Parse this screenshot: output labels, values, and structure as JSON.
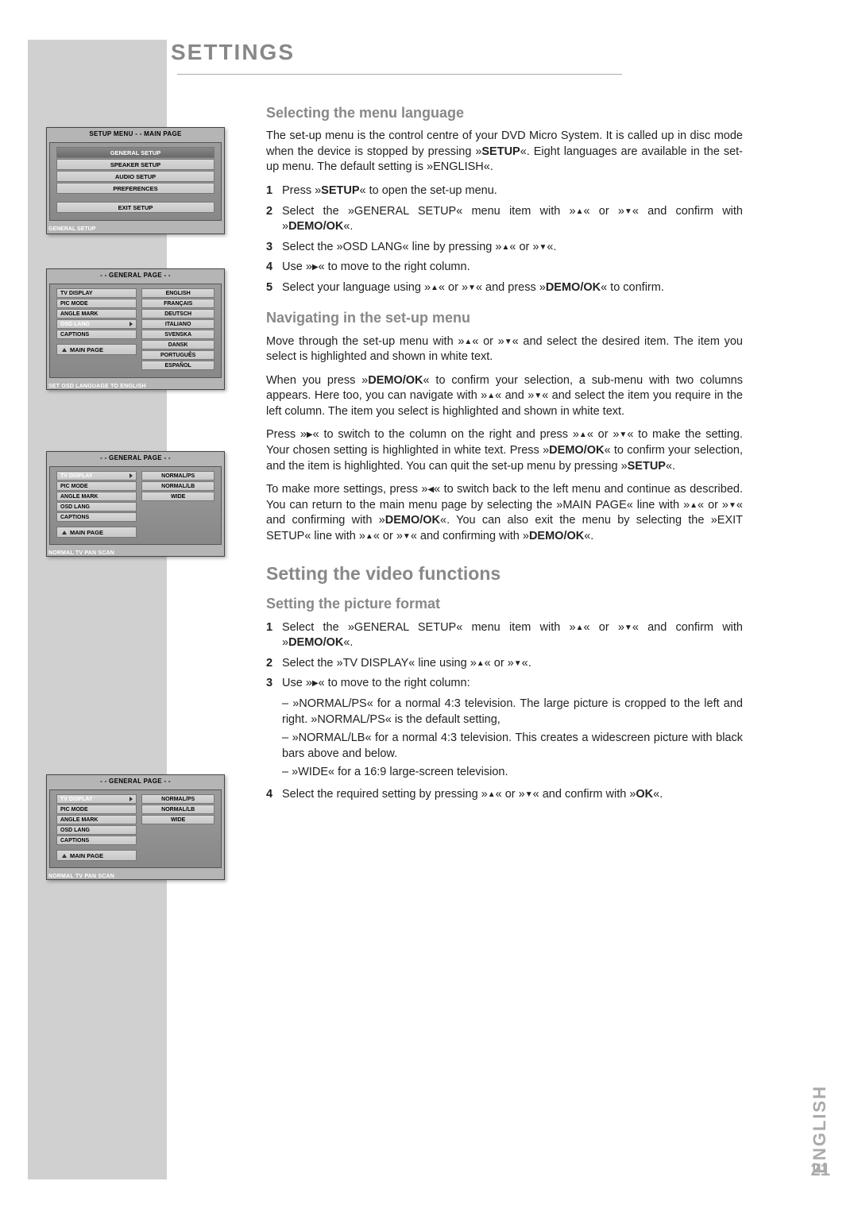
{
  "header": "SETTINGS",
  "page_language": "ENGLISH",
  "page_number": "21",
  "osd1": {
    "title": "SETUP MENU - - MAIN PAGE",
    "items": [
      "GENERAL SETUP",
      "SPEAKER SETUP",
      "AUDIO SETUP",
      "PREFERENCES"
    ],
    "exit": "EXIT SETUP",
    "status": "GENERAL SETUP"
  },
  "osd2": {
    "title": "- - GENERAL PAGE - -",
    "left": [
      "TV DISPLAY",
      "PIC MODE",
      "ANGLE MARK",
      "OSD LANG",
      "CAPTIONS"
    ],
    "selected_left": "OSD LANG",
    "right": [
      "ENGLISH",
      "FRANÇAIS",
      "DEUTSCH",
      "ITALIANO",
      "SVENSKA",
      "DANSK",
      "PORTUGUÊS",
      "ESPAÑOL"
    ],
    "selected_right": "ENGLISH",
    "nav": "MAIN PAGE",
    "foot": "SET OSD LANGUAGE TO ENGLISH"
  },
  "osd3": {
    "title": "- - GENERAL PAGE - -",
    "left": [
      "TV DISPLAY",
      "PIC MODE",
      "ANGLE MARK",
      "OSD LANG",
      "CAPTIONS"
    ],
    "selected_left": "TV DISPLAY",
    "right": [
      "NORMAL/PS",
      "NORMAL/LB",
      "WIDE"
    ],
    "selected_right": "NORMAL/PS",
    "nav": "MAIN PAGE",
    "foot": "NORMAL TV PAN SCAN"
  },
  "osd4": {
    "title": "- - GENERAL PAGE - -",
    "left": [
      "TV DISPLAY",
      "PIC MODE",
      "ANGLE MARK",
      "OSD LANG",
      "CAPTIONS"
    ],
    "selected_left": "TV DISPLAY",
    "right": [
      "NORMAL/PS",
      "NORMAL/LB",
      "WIDE"
    ],
    "selected_right": "NORMAL/PS",
    "nav": "MAIN PAGE",
    "foot": "NORMAL TV PAN SCAN"
  },
  "sec1": {
    "title": "Selecting the menu language",
    "intro": "The set-up menu is the control centre of your DVD Micro System. It is called up in disc mode when the device is stopped by pressing »",
    "intro_bold": "SETUP",
    "intro2": "«. Eight languages are available in the set-up menu. The default setting is »ENGLISH«.",
    "s1a": "Press »",
    "s1b": "SETUP",
    "s1c": "« to open the set-up menu.",
    "s2a": "Select the »GENERAL SETUP« menu item with »",
    "s2b": "« or »",
    "s2c": "« and confirm with »",
    "s2d": "DEMO/OK",
    "s2e": "«.",
    "s3a": "Select the »OSD LANG« line by pressing »",
    "s3b": "« or »",
    "s3c": "«.",
    "s4a": "Use »",
    "s4b": "« to move to the right column.",
    "s5a": "Select your language using »",
    "s5b": "« or »",
    "s5c": "« and press »",
    "s5d": "DEMO/OK",
    "s5e": "« to confirm."
  },
  "sec2": {
    "title": "Navigating in the set-up menu",
    "p1a": "Move through the set-up menu with »",
    "p1b": "« or »",
    "p1c": "« and select the desired item. The item you select is highlighted and shown in white text.",
    "p2a": "When you press »",
    "p2b": "DEMO/OK",
    "p2c": "« to confirm your selection, a sub-menu with two columns appears. Here too, you can navigate with »",
    "p2d": "« and »",
    "p2e": "« and select the item you require in the left column. The item you select is highlighted and shown in white text.",
    "p3a": "Press »",
    "p3b": "« to switch to the column on the right and press »",
    "p3c": "« or »",
    "p3d": "« to make the setting. Your chosen setting is highlighted in white text. Press »",
    "p3e": "DEMO/OK",
    "p3f": "« to confirm your selection, and the item is highlighted. You can quit the set-up menu by pressing »",
    "p3g": "SETUP",
    "p3h": "«.",
    "p4a": "To make more settings, press »",
    "p4b": "« to switch back to the left menu and continue as described. You can return to the main menu page by selecting the »MAIN PAGE« line with »",
    "p4c": "« or »",
    "p4d": "« and confirming with »",
    "p4e": "DEMO/OK",
    "p4f": "«. You can also exit the menu by selecting the »EXIT SETUP« line with »",
    "p4g": "« or »",
    "p4h": "« and confirming with »",
    "p4i": "DEMO/OK",
    "p4j": "«."
  },
  "sec3": {
    "title": "Setting the video functions",
    "sub": "Setting the picture format",
    "s1a": "Select the »GENERAL SETUP« menu item with »",
    "s1b": "« or »",
    "s1c": "« and confirm with »",
    "s1d": "DEMO/OK",
    "s1e": "«.",
    "s2a": "Select the »TV DISPLAY« line using »",
    "s2b": "« or »",
    "s2c": "«.",
    "s3a": "Use »",
    "s3b": "« to move to the right column:",
    "s3sub1": "– »NORMAL/PS« for a normal 4:3 television. The large picture is cropped to the left and right. »NORMAL/PS« is the default setting,",
    "s3sub2": "– »NORMAL/LB« for a normal 4:3 television. This creates a widescreen picture with black bars above and below.",
    "s3sub3": "– »WIDE« for a 16:9 large-screen television.",
    "s4a": "Select the required setting by pressing »",
    "s4b": "« or »",
    "s4c": "« and confirm with »",
    "s4d": "OK",
    "s4e": "«."
  }
}
